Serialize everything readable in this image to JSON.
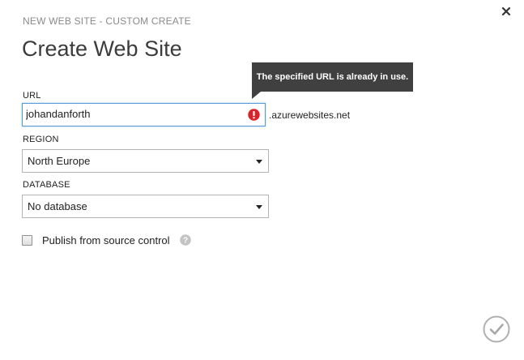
{
  "header": {
    "subtitle": "NEW WEB SITE - CUSTOM CREATE",
    "title": "Create Web Site"
  },
  "url_field": {
    "label": "URL",
    "value": "johandanforth",
    "suffix": ".azurewebsites.net",
    "error_tooltip": "The specified URL is already in use."
  },
  "region_field": {
    "label": "REGION",
    "selected": "North Europe"
  },
  "database_field": {
    "label": "DATABASE",
    "selected": "No database"
  },
  "publish_option": {
    "label": "Publish from source control",
    "checked": false
  },
  "icons": {
    "close": "close-icon",
    "error": "error-icon",
    "dropdown": "chevron-down-icon",
    "help": "help-icon",
    "confirm": "checkmark-icon"
  },
  "colors": {
    "tooltip_bg": "#404040",
    "error_red": "#d8232a",
    "focus_border": "#5b9bd5",
    "muted_text": "#8a8a8a"
  }
}
